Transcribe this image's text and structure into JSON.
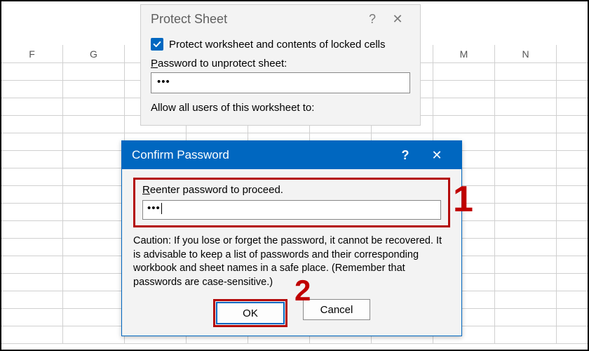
{
  "spreadsheet": {
    "columns": [
      "F",
      "G",
      "",
      "",
      "",
      "",
      "",
      "M",
      "N"
    ]
  },
  "protect_dialog": {
    "title": "Protect Sheet",
    "help": "?",
    "close": "✕",
    "checkbox_label_pre": "Protect worksheet and ",
    "checkbox_label_ul": "c",
    "checkbox_label_post": "ontents of locked cells",
    "password_label_ul": "P",
    "password_label_post": "assword to unprotect sheet:",
    "password_value": "•••",
    "allow_label_ul": "A",
    "allow_label_post": "llow all users of this worksheet to:"
  },
  "confirm_dialog": {
    "title": "Confirm Password",
    "help": "?",
    "close": "✕",
    "reenter_label_ul": "R",
    "reenter_label_post": "eenter password to proceed.",
    "reenter_value": "•••",
    "caution": "Caution: If you lose or forget the password, it cannot be recovered. It is advisable to keep a list of passwords and their corresponding workbook and sheet names in a safe place.  (Remember that passwords are case-sensitive.)",
    "ok_label": "OK",
    "cancel_label": "Cancel"
  },
  "annotations": {
    "one": "1",
    "two": "2"
  }
}
